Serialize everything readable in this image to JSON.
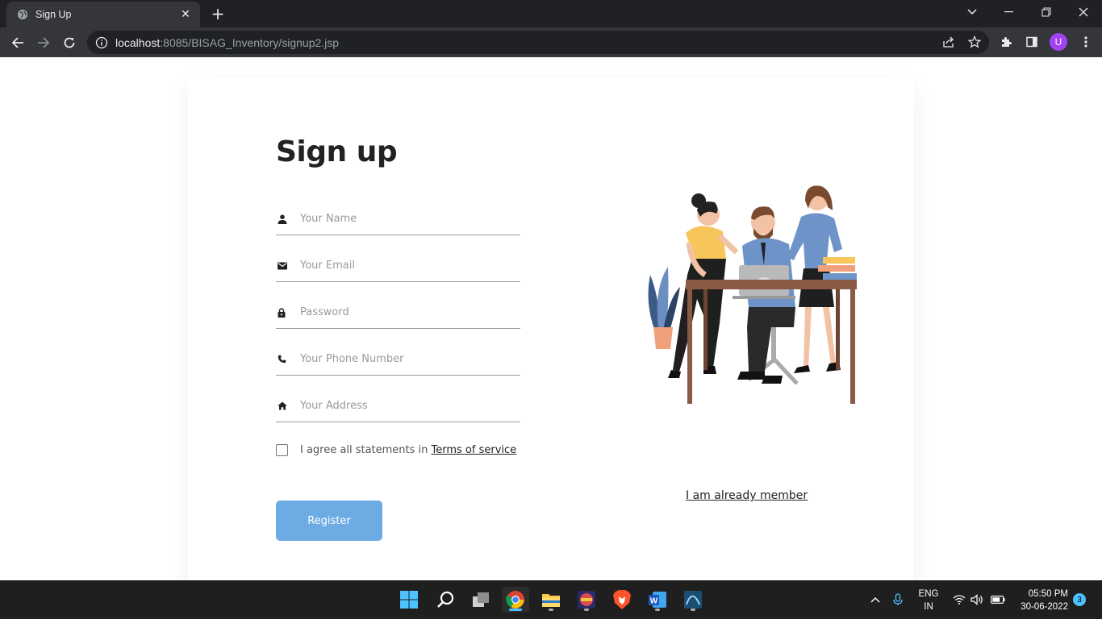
{
  "browser": {
    "tab_title": "Sign Up",
    "url_host": "localhost",
    "url_rest": ":8085/BISAG_Inventory/signup2.jsp",
    "profile_initial": "U"
  },
  "form": {
    "heading": "Sign up",
    "fields": [
      {
        "icon": "person-icon",
        "placeholder": "Your Name"
      },
      {
        "icon": "mail-icon",
        "placeholder": "Your Email"
      },
      {
        "icon": "lock-icon",
        "placeholder": "Password"
      },
      {
        "icon": "phone-icon",
        "placeholder": "Your Phone Number"
      },
      {
        "icon": "home-icon",
        "placeholder": "Your Address"
      }
    ],
    "agree_text": "I agree all statements in ",
    "terms_link": "Terms of service",
    "register_label": "Register",
    "member_link": "I am already member"
  },
  "colors": {
    "register_button": "#6dabe4",
    "chrome_dark": "#202124",
    "chrome_toolbar": "#35363a",
    "taskbar": "#1f1f1f"
  },
  "taskbar": {
    "apps": [
      "windows-start-icon",
      "search-icon",
      "task-view-icon",
      "chrome-icon",
      "file-explorer-icon",
      "app-icon",
      "brave-icon",
      "word-icon",
      "mysql-workbench-icon"
    ],
    "lang_line1": "ENG",
    "lang_line2": "IN",
    "time": "05:50 PM",
    "date": "30-06-2022",
    "notification_count": "3"
  }
}
